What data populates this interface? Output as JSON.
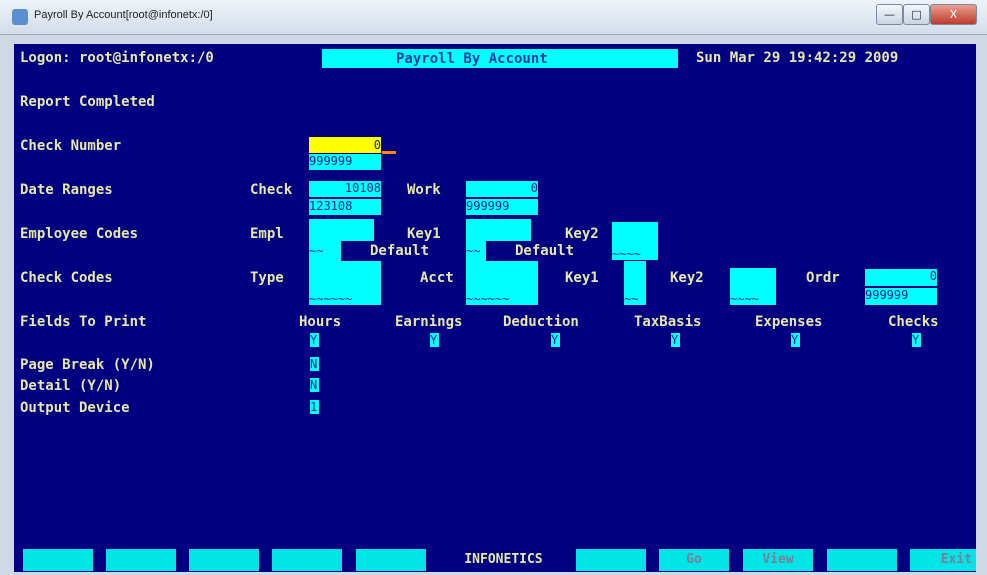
{
  "window": {
    "title": "Payroll By Account[root@infonetx:/0]",
    "min_label": "—",
    "max_label": "□",
    "close_label": "X"
  },
  "header": {
    "logon": "Logon: root@infonetx:/0",
    "title": "Payroll By Account",
    "datetime": "Sun Mar 29 19:42:29 2009"
  },
  "status": "Report Completed",
  "labels": {
    "check_number": "Check Number",
    "date_ranges": "Date Ranges",
    "employee_codes": "Employee Codes",
    "check_codes": "Check Codes",
    "fields_to_print": "Fields To Print",
    "page_break": "Page Break (Y/N)",
    "detail": "Detail (Y/N)",
    "output_device": "Output Device"
  },
  "check_number": {
    "from": "0",
    "to": "999999"
  },
  "date_ranges": {
    "check_label": "Check",
    "check_from": "10108",
    "check_to": "123108",
    "work_label": "Work",
    "work_from": "0",
    "work_to": "999999"
  },
  "employee_codes": {
    "empl_label": "Empl",
    "empl_value": "~~",
    "key1_label": "Key1",
    "key1_default": "Default",
    "key1_value": "~~",
    "key2_label": "Key2",
    "key2_default": "Default",
    "key2_value": "~~~~"
  },
  "check_codes": {
    "type_label": "Type",
    "type_value": "~~~~~~",
    "acct_label": "Acct",
    "acct_value": "~~~~~~",
    "key1_label": "Key1",
    "key1_value": "~~",
    "key2_label": "Key2",
    "key2_value": "~~~~",
    "ordr_label": "Ordr",
    "ordr_from": "0",
    "ordr_to": "999999"
  },
  "fields_to_print": [
    {
      "label": "Hours",
      "value": "Y"
    },
    {
      "label": "Earnings",
      "value": "Y"
    },
    {
      "label": "Deduction",
      "value": "Y"
    },
    {
      "label": "TaxBasis",
      "value": "Y"
    },
    {
      "label": "Expenses",
      "value": "Y"
    },
    {
      "label": "Checks",
      "value": "Y"
    }
  ],
  "options": {
    "page_break": "N",
    "detail": "N",
    "output_device": "1"
  },
  "fkeys": [
    "",
    "",
    "",
    "",
    "",
    "INFONETICS",
    "",
    "Go",
    "View",
    "",
    "Exit"
  ]
}
